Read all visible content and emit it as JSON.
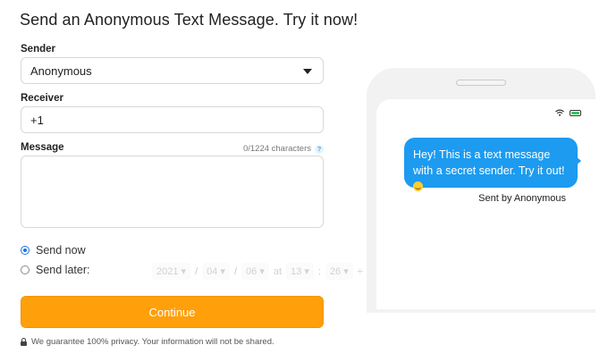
{
  "page": {
    "title": "Send an Anonymous Text Message. Try it now!"
  },
  "form": {
    "sender_label": "Sender",
    "sender_value": "Anonymous",
    "receiver_label": "Receiver",
    "receiver_value": "+1",
    "message_label": "Message",
    "char_count": "0/1224 characters",
    "help_glyph": "?",
    "send_now_label": "Send now",
    "send_later_label": "Send later:",
    "send_mode": "now",
    "schedule": {
      "year": "2021",
      "month": "04",
      "day": "06",
      "at": "at",
      "hour": "13",
      "minute": "26"
    },
    "continue_label": "Continue",
    "privacy_text": "We guarantee 100% privacy. Your information will not be shared."
  },
  "preview": {
    "message": "Hey! This is a text message with a secret sender. Try it out!",
    "sent_by": "Sent by Anonymous"
  },
  "colors": {
    "accent": "#ff9f0a",
    "bubble": "#1c9bf0",
    "radio_selected": "#1a73e8",
    "battery": "#34c759"
  },
  "icons": [
    "caret-down-icon",
    "help-icon",
    "radio-icon",
    "lock-icon",
    "wifi-icon",
    "battery-icon",
    "grin-emoji-icon"
  ]
}
